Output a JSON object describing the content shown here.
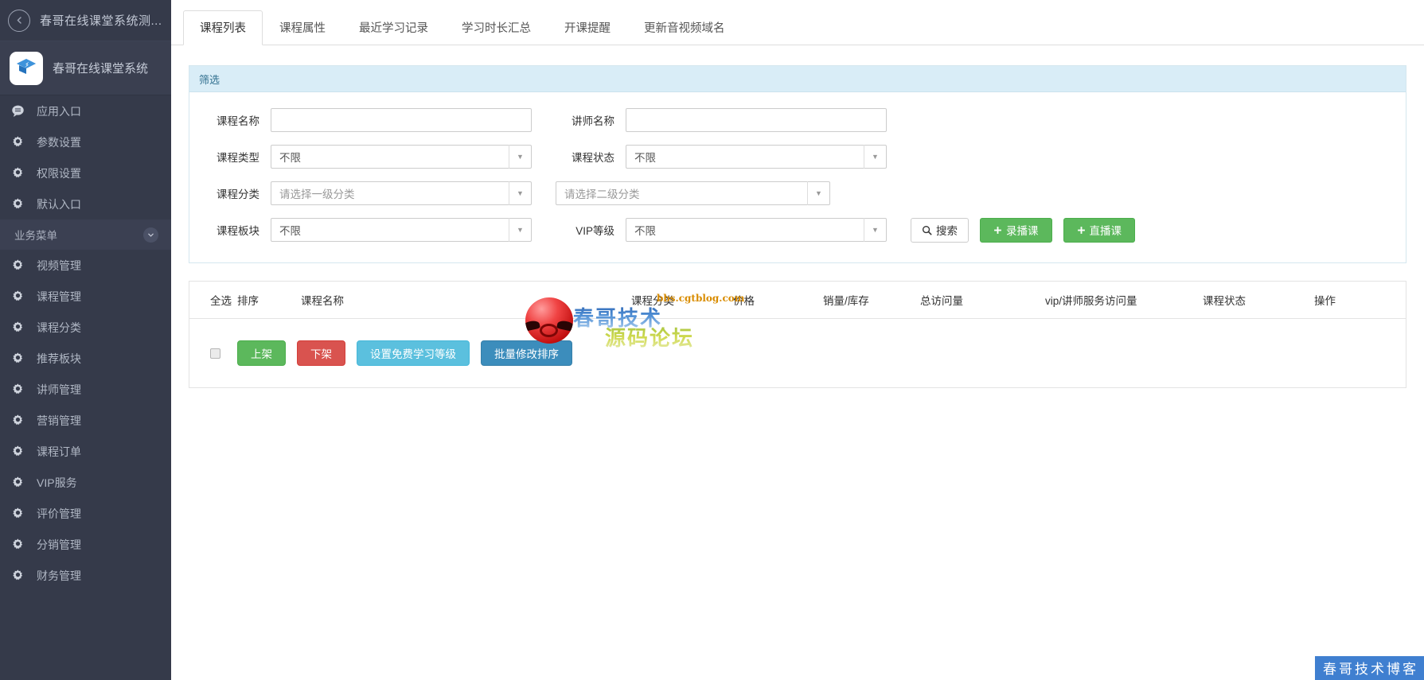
{
  "sidebar": {
    "top_title": "春哥在线课堂系统测...",
    "back_icon": "chevron-left-icon",
    "brand_name": "春哥在线课堂系统",
    "brand_icon": "graduation-cap-icon",
    "items": [
      {
        "label": "应用入口",
        "icon": "chat-bubble-icon"
      },
      {
        "label": "参数设置",
        "icon": "gear-icon"
      },
      {
        "label": "权限设置",
        "icon": "gear-icon"
      },
      {
        "label": "默认入口",
        "icon": "gear-icon"
      }
    ],
    "section": {
      "label": "业务菜单",
      "caret_icon": "chevron-down-icon"
    },
    "biz_items": [
      {
        "label": "视频管理",
        "icon": "gear-icon"
      },
      {
        "label": "课程管理",
        "icon": "gear-icon"
      },
      {
        "label": "课程分类",
        "icon": "gear-icon"
      },
      {
        "label": "推荐板块",
        "icon": "gear-icon"
      },
      {
        "label": "讲师管理",
        "icon": "gear-icon"
      },
      {
        "label": "营销管理",
        "icon": "gear-icon"
      },
      {
        "label": "课程订单",
        "icon": "gear-icon"
      },
      {
        "label": "VIP服务",
        "icon": "gear-icon"
      },
      {
        "label": "评价管理",
        "icon": "gear-icon"
      },
      {
        "label": "分销管理",
        "icon": "gear-icon"
      },
      {
        "label": "财务管理",
        "icon": "gear-icon"
      }
    ]
  },
  "tabs": [
    {
      "label": "课程列表",
      "active": true
    },
    {
      "label": "课程属性",
      "active": false
    },
    {
      "label": "最近学习记录",
      "active": false
    },
    {
      "label": "学习时长汇总",
      "active": false
    },
    {
      "label": "开课提醒",
      "active": false
    },
    {
      "label": "更新音视频域名",
      "active": false
    }
  ],
  "filter": {
    "title": "筛选",
    "course_name": {
      "label": "课程名称",
      "value": "",
      "placeholder": ""
    },
    "teacher_name": {
      "label": "讲师名称",
      "value": "",
      "placeholder": ""
    },
    "course_type": {
      "label": "课程类型",
      "value": "不限"
    },
    "course_status": {
      "label": "课程状态",
      "value": "不限"
    },
    "course_category": {
      "label": "课程分类",
      "value_level1": "请选择一级分类",
      "value_level2": "请选择二级分类"
    },
    "course_block": {
      "label": "课程板块",
      "value": "不限"
    },
    "vip_level": {
      "label": "VIP等级",
      "value": "不限"
    },
    "search_button": "搜索",
    "search_icon": "search-icon",
    "record_course_button": "录播课",
    "live_course_button": "直播课",
    "plus_icon": "plus-icon"
  },
  "table": {
    "headers": [
      "全选",
      "排序",
      "课程名称",
      "课程分类",
      "价格",
      "销量/库存",
      "总访问量",
      "vip/讲师服务访问量",
      "课程状态",
      "操作"
    ],
    "rows": [],
    "select_all_checkbox": false,
    "actions": [
      {
        "label": "上架",
        "color": "#5cb85c"
      },
      {
        "label": "下架",
        "color": "#d9534f"
      },
      {
        "label": "设置免费学习等级",
        "color": "#5bc0de"
      },
      {
        "label": "批量修改排序",
        "color": "#3c8dbc"
      }
    ]
  },
  "watermark": {
    "line1": "春哥技术",
    "line2": "源码论坛",
    "url": "bbs.cgtblog.com"
  },
  "corner_badge": "春哥技术博客",
  "colors": {
    "sidebar_bg": "#353a4a",
    "sidebar_section_bg": "#3b4052",
    "panel_head_bg": "#d9edf7",
    "panel_head_text": "#31708f",
    "green": "#5cb85c",
    "red": "#d9534f",
    "cyan": "#5bc0de",
    "blue": "#3c8dbc",
    "badge_blue": "#3f7fd0"
  }
}
